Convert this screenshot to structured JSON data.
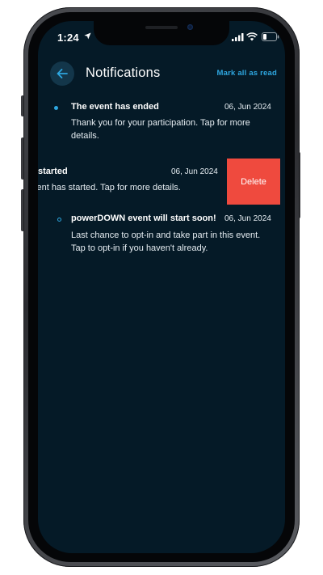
{
  "status_bar": {
    "time": "1:24"
  },
  "header": {
    "title": "Notifications",
    "mark_all": "Mark all as read",
    "back_icon": "arrow-left-icon"
  },
  "notifications": [
    {
      "title": "The event has ended",
      "date": "06, Jun 2024",
      "body": "Thank you for your participation. Tap for more details.",
      "unread": true
    },
    {
      "title": "started",
      "date": "06, Jun 2024",
      "body": "vent has started. Tap for more details.",
      "swiped": true,
      "delete_label": "Delete"
    },
    {
      "title": "powerDOWN event will start soon!",
      "date": "06, Jun 2024",
      "body": "Last chance to opt-in and take part in this event. Tap to opt-in if you haven't already.",
      "unread": false
    }
  ],
  "colors": {
    "background": "#051a27",
    "accent": "#2ea7e0",
    "delete": "#ef4a3e",
    "text": "#ffffff"
  }
}
